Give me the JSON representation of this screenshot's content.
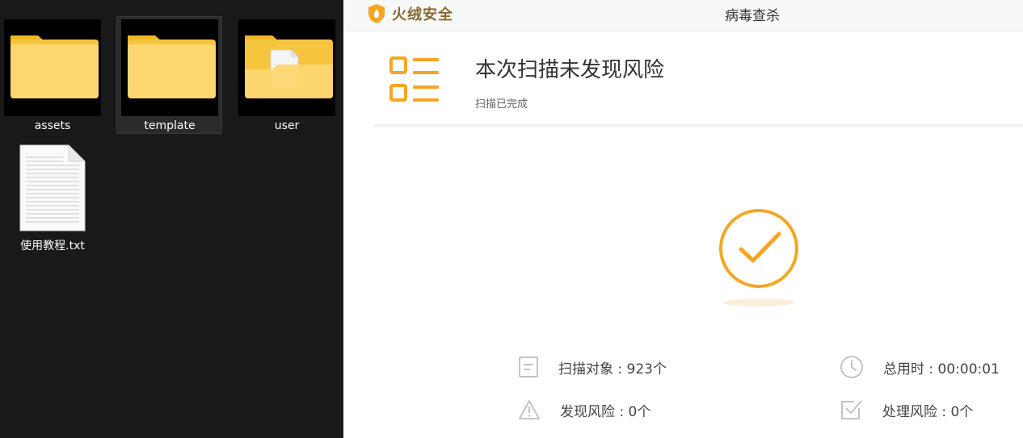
{
  "explorer": {
    "items": [
      {
        "name": "assets",
        "kind": "folder"
      },
      {
        "name": "template",
        "kind": "folder",
        "selected": true
      },
      {
        "name": "user",
        "kind": "folder-with-file"
      },
      {
        "name": "使用教程.txt",
        "kind": "text-file"
      }
    ]
  },
  "app": {
    "brand": "火绒安全",
    "window_title": "病毒查杀",
    "accent_color": "#f5a623"
  },
  "result": {
    "title": "本次扫描未发现风险",
    "subtitle": "扫描已完成"
  },
  "stats": {
    "scanned": "扫描对象 : 923个",
    "duration": "总用时 : 00:00:01",
    "found": "发现风险 : 0个",
    "handled": "处理风险 : 0个"
  }
}
